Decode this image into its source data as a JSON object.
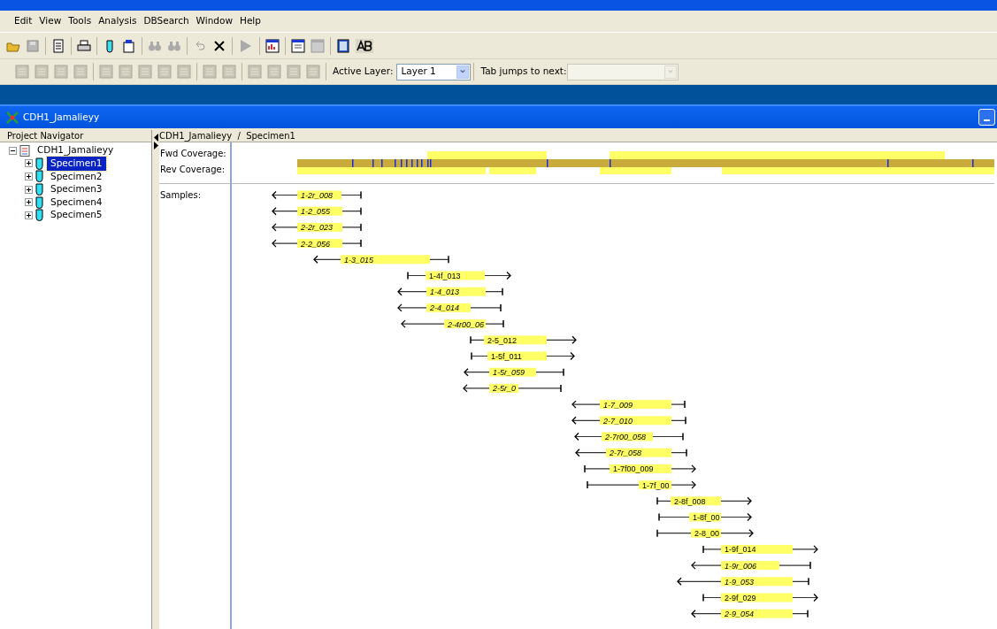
{
  "menu": [
    "Edit",
    "View",
    "Tools",
    "Analysis",
    "DBSearch",
    "Window",
    "Help"
  ],
  "layer_toolbar": {
    "active_layer_label": "Active Layer:",
    "active_layer": "Layer 1",
    "tab_jumps_label": "Tab jumps to next:"
  },
  "document_window": {
    "title": "CDH1_Jamalieyy"
  },
  "navigator": {
    "title": "Project Navigator",
    "tree": [
      {
        "label": "CDH1_Jamalieyy",
        "expanded": true,
        "selected": false,
        "children": [
          {
            "label": "Specimen1",
            "expanded": false,
            "selected": true
          },
          {
            "label": "Specimen2",
            "expanded": false,
            "selected": false
          },
          {
            "label": "Specimen3",
            "expanded": false,
            "selected": false
          },
          {
            "label": "Specimen4",
            "expanded": false,
            "selected": false
          },
          {
            "label": "Specimen5",
            "expanded": false,
            "selected": false
          }
        ]
      }
    ]
  },
  "view": {
    "breadcrumb": "CDH1_Jamalieyy  /  Specimen1",
    "track_labels": [
      "Fwd Coverage:",
      "Rev Coverage:"
    ],
    "samples_label": "Samples:",
    "samples": [
      {
        "name": "1-2r_008",
        "kind": "reverse"
      },
      {
        "name": "1-2_055",
        "kind": "reverse"
      },
      {
        "name": "2-2r_023",
        "kind": "reverse"
      },
      {
        "name": "2-2_056",
        "kind": "reverse"
      },
      {
        "name": "1-3_015",
        "kind": "reverse"
      },
      {
        "name": "1-4f_013",
        "kind": "forward"
      },
      {
        "name": "1-4_013",
        "kind": "reverse"
      },
      {
        "name": "2-4_014",
        "kind": "reverse"
      },
      {
        "name": "2-4r00_06",
        "kind": "reverse"
      },
      {
        "name": "2-5_012",
        "kind": "forward"
      },
      {
        "name": "1-5f_011",
        "kind": "forward"
      },
      {
        "name": "1-5r_059",
        "kind": "reverse"
      },
      {
        "name": "2-5r_0",
        "kind": "reverse"
      },
      {
        "name": "1-7_009",
        "kind": "reverse"
      },
      {
        "name": "2-7_010",
        "kind": "reverse"
      },
      {
        "name": "2-7r00_058",
        "kind": "reverse"
      },
      {
        "name": "2-7r_058",
        "kind": "reverse"
      },
      {
        "name": "1-7f00_009",
        "kind": "forward"
      },
      {
        "name": "1-7f_00",
        "kind": "forward"
      },
      {
        "name": "2-8f_008",
        "kind": "forward"
      },
      {
        "name": "1-8f_00",
        "kind": "forward"
      },
      {
        "name": "2-8_00",
        "kind": "forward"
      },
      {
        "name": "1-9f_014",
        "kind": "forward"
      },
      {
        "name": "1-9r_006",
        "kind": "reverse"
      },
      {
        "name": "1-9_053",
        "kind": "reverse"
      },
      {
        "name": "2-9f_029",
        "kind": "forward"
      },
      {
        "name": "2-9_054",
        "kind": "reverse"
      }
    ]
  }
}
